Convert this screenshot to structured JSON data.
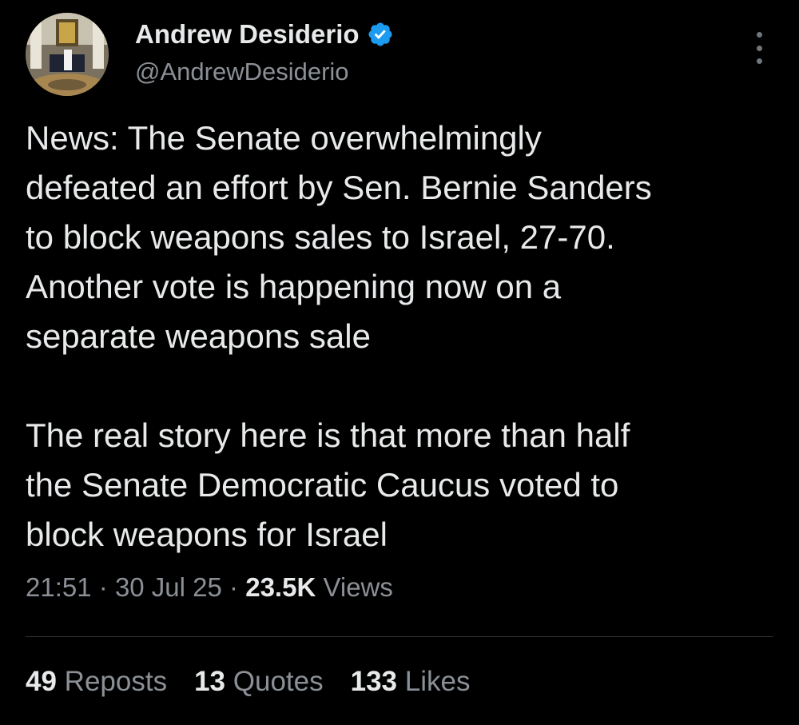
{
  "author": {
    "display_name": "Andrew Desiderio",
    "handle": "@AndrewDesiderio",
    "verified": true
  },
  "tweet": {
    "text": "News: The Senate overwhelmingly\ndefeated an effort by Sen. Bernie Sanders\nto block weapons sales to Israel, 27-70.\nAnother vote is happening now on a\nseparate weapons sale\n\nThe real story here is that more than half\nthe Senate Democratic Caucus voted to\nblock weapons for Israel",
    "time": "21:51",
    "separator": "·",
    "date": "30 Jul 25",
    "views_count": "23.5K",
    "views_label": "Views"
  },
  "stats": {
    "reposts_count": "49",
    "reposts_label": "Reposts",
    "quotes_count": "13",
    "quotes_label": "Quotes",
    "likes_count": "133",
    "likes_label": "Likes"
  },
  "icons": {
    "verified": "verified-badge-icon",
    "more": "more-options-icon"
  },
  "colors": {
    "background": "#000000",
    "primary_text": "#e7e9ea",
    "secondary_text": "#8b9096",
    "verified_blue": "#1d9bf0",
    "divider": "#2f3336"
  }
}
